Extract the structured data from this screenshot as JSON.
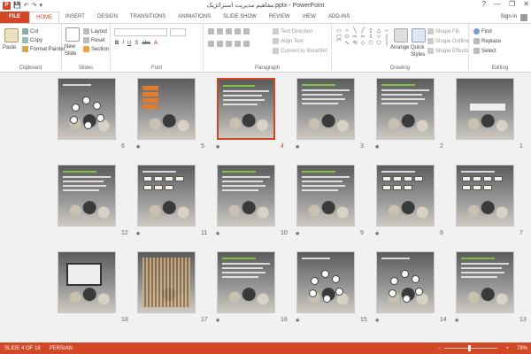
{
  "window": {
    "title": "مفاهیم مدیریت استراتژیک.pptx - PowerPoint",
    "minimize": "—",
    "maximize": "❐",
    "close": "✕",
    "help": "?"
  },
  "qat": {
    "app_icon": "P",
    "save": "💾",
    "undo": "↶",
    "redo": "↷",
    "customize": "▾"
  },
  "tabs": [
    {
      "label": "FILE"
    },
    {
      "label": "HOME"
    },
    {
      "label": "INSERT"
    },
    {
      "label": "DESIGN"
    },
    {
      "label": "TRANSITIONS"
    },
    {
      "label": "ANIMATIONS"
    },
    {
      "label": "SLIDE SHOW"
    },
    {
      "label": "REVIEW"
    },
    {
      "label": "VIEW"
    },
    {
      "label": "ADD-INS"
    }
  ],
  "signin": "Sign in",
  "ribbon": {
    "clipboard": {
      "label": "Clipboard",
      "paste": "Paste",
      "cut": "Cut",
      "copy": "Copy",
      "format_painter": "Format Painter"
    },
    "slides": {
      "label": "Slides",
      "new_slide": "New",
      "new_slide2": "Slide",
      "layout": "Layout",
      "reset": "Reset",
      "section": "Section"
    },
    "font": {
      "label": "Font"
    },
    "paragraph": {
      "label": "Paragraph",
      "text_direction": "Text Direction",
      "align_text": "Align Text",
      "convert": "Convert to SmartArt"
    },
    "drawing": {
      "label": "Drawing",
      "arrange": "Arrange",
      "quick_styles": "Quick",
      "quick_styles2": "Styles",
      "shape_fill": "Shape Fill",
      "shape_outline": "Shape Outline",
      "shape_effects": "Shape Effects"
    },
    "editing": {
      "label": "Editing",
      "find": "Find",
      "replace": "Replace",
      "select": "Select"
    }
  },
  "slides": [
    {
      "n": "1",
      "selected": false,
      "star": false
    },
    {
      "n": "2",
      "selected": false,
      "star": true
    },
    {
      "n": "3",
      "selected": false,
      "star": true
    },
    {
      "n": "4",
      "selected": true,
      "star": true
    },
    {
      "n": "5",
      "selected": false,
      "star": true
    },
    {
      "n": "6",
      "selected": false,
      "star": false
    },
    {
      "n": "7",
      "selected": false,
      "star": false
    },
    {
      "n": "8",
      "selected": false,
      "star": true
    },
    {
      "n": "9",
      "selected": false,
      "star": true
    },
    {
      "n": "10",
      "selected": false,
      "star": true
    },
    {
      "n": "11",
      "selected": false,
      "star": true
    },
    {
      "n": "12",
      "selected": false,
      "star": false
    },
    {
      "n": "13",
      "selected": false,
      "star": true
    },
    {
      "n": "14",
      "selected": false,
      "star": true
    },
    {
      "n": "15",
      "selected": false,
      "star": true
    },
    {
      "n": "16",
      "selected": false,
      "star": true
    },
    {
      "n": "17",
      "selected": false,
      "star": false
    },
    {
      "n": "18",
      "selected": false,
      "star": false
    }
  ],
  "star_glyph": "★",
  "status": {
    "slide": "SLIDE 4 OF 18",
    "language": "PERSIAN",
    "zoom": "78%",
    "zoom_fraction": 0.78,
    "minus": "−",
    "plus": "+"
  },
  "colors": {
    "accent": "#d24726",
    "background": "#f1f1f1"
  }
}
